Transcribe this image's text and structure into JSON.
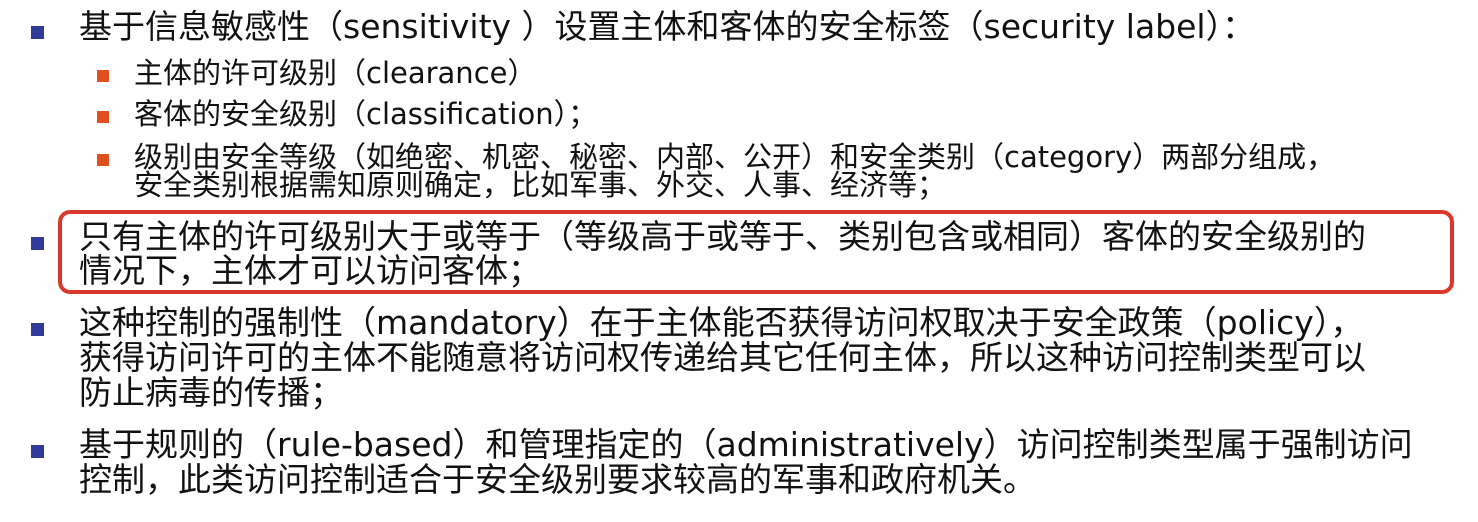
{
  "content": {
    "b1": {
      "line1": "基于信息敏感性（sensitivity ）设置主体和客体的安全标签（security label）："
    },
    "s1": {
      "line1": "主体的许可级别（clearance）"
    },
    "s2": {
      "line1": "客体的安全级别（classification）；"
    },
    "s3": {
      "line1": "级别由安全等级（如绝密、机密、秘密、内部、公开）和安全类别（category）两部分组成，",
      "line2": "安全类别根据需知原则确定，比如军事、外交、人事、经济等；"
    },
    "b2": {
      "line1": "只有主体的许可级别大于或等于（等级高于或等于、类别包含或相同）客体的安全级别的",
      "line2": "情况下，主体才可以访问客体；"
    },
    "b3": {
      "line1": "这种控制的强制性（mandatory）在于主体能否获得访问权取决于安全政策（policy），",
      "line2": "获得访问许可的主体不能随意将访问权传递给其它任何主体，所以这种访问控制类型可以",
      "line3": "防止病毒的传播；"
    },
    "b4": {
      "line1": "基于规则的（rule-based）和管理指定的（administratively）访问控制类型属于强制访问",
      "line2": "控制，此类访问控制适合于安全级别要求较高的军事和政府机关。"
    }
  },
  "colors": {
    "main_bullet": "#2f3a9a",
    "sub_bullet": "#e0501f",
    "highlight_border": "#d9372b",
    "text": "#111111"
  }
}
